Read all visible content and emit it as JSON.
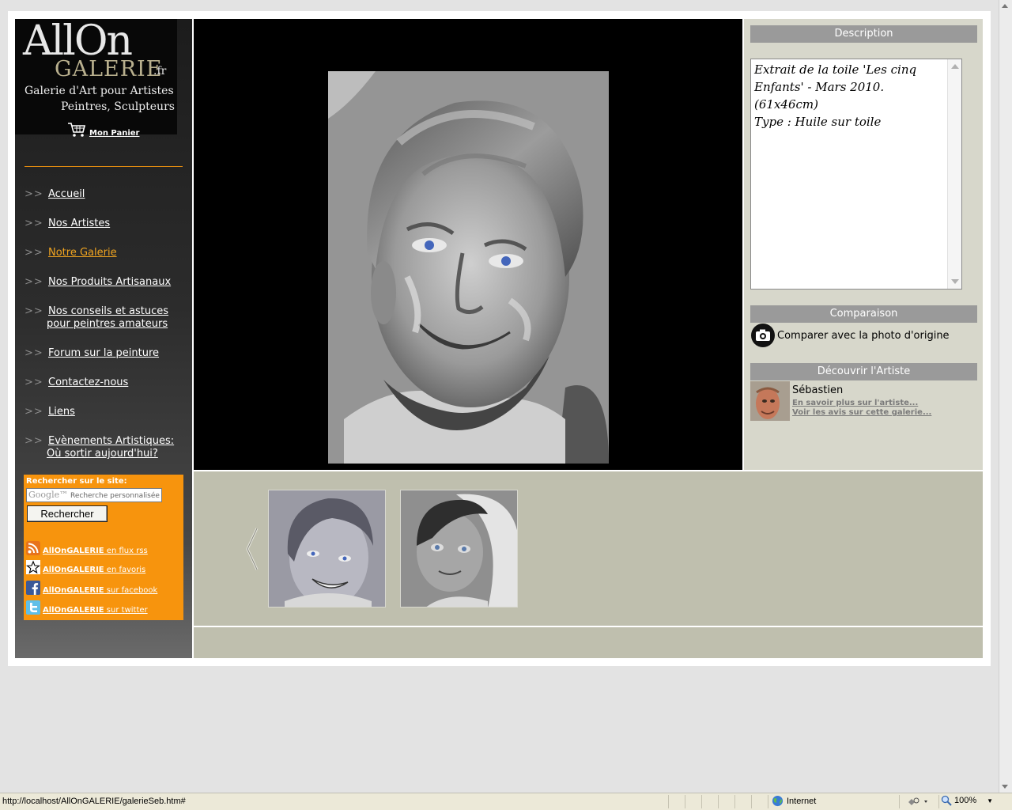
{
  "sidebar": {
    "logo": {
      "line1": "AllOn",
      "line2": "GALERIE",
      "tld": ".fr",
      "tagline1": "Galerie d'Art pour Artistes",
      "tagline2": "Peintres, Sculpteurs"
    },
    "cart_label": "Mon Panier",
    "nav_marker": ">>",
    "nav": [
      {
        "label": "Accueil"
      },
      {
        "label": "Nos Artistes"
      },
      {
        "label": "Notre Galerie",
        "active": true
      },
      {
        "label": "Nos Produits Artisanaux"
      },
      {
        "label": "Nos conseils et astuces",
        "label2": "pour peintres amateurs"
      },
      {
        "label": "Forum sur la peinture"
      },
      {
        "label": "Contactez-nous"
      },
      {
        "label": "Liens"
      },
      {
        "label": "Evènements Artistiques:",
        "label2": "Où sortir aujourd'hui?"
      }
    ],
    "search": {
      "label": "Rechercher sur le site:",
      "brand": "Google™",
      "placeholder": "Recherche personnalisée",
      "button": "Rechercher"
    },
    "social": [
      {
        "icon": "rss-icon",
        "brand": "AllOnGALERIE",
        "text": " en flux rss"
      },
      {
        "icon": "star-favorites-icon",
        "brand": "AllOnGALERIE",
        "text": " en favoris"
      },
      {
        "icon": "facebook-icon",
        "brand": "AllOnGALERIE",
        "text": " sur facebook"
      },
      {
        "icon": "twitter-icon",
        "brand": "AllOnGALERIE",
        "text": " sur twitter"
      }
    ]
  },
  "panel": {
    "description_title": "Description",
    "description_lines": [
      "Extrait de la toile 'Les cinq",
      "Enfants' - Mars 2010. (61x46cm)",
      "Type : Huile sur toile"
    ],
    "comparison_title": "Comparaison",
    "compare_label": "Comparer avec la photo d'origine",
    "artist_title": "Découvrir l'Artiste",
    "artist_name": "Sébastien",
    "artist_link1": "En savoir plus sur l'artiste...",
    "artist_link2": "Voir les avis sur cette galerie..."
  },
  "gallery": {
    "thumbnails": [
      {
        "name": "thumbnail-boy-portrait"
      },
      {
        "name": "thumbnail-girl-portrait"
      }
    ]
  },
  "statusbar": {
    "url": "http://localhost/AllOnGALERIE/galerieSeb.htm#",
    "zone": "Internet",
    "zoom": "100%"
  },
  "colors": {
    "accent_orange": "#f7940d",
    "active_nav": "#f0a420",
    "panel_bg": "#d7d7cb",
    "thumb_bg": "#bfbfae",
    "section_bar": "#9a9a9a"
  }
}
